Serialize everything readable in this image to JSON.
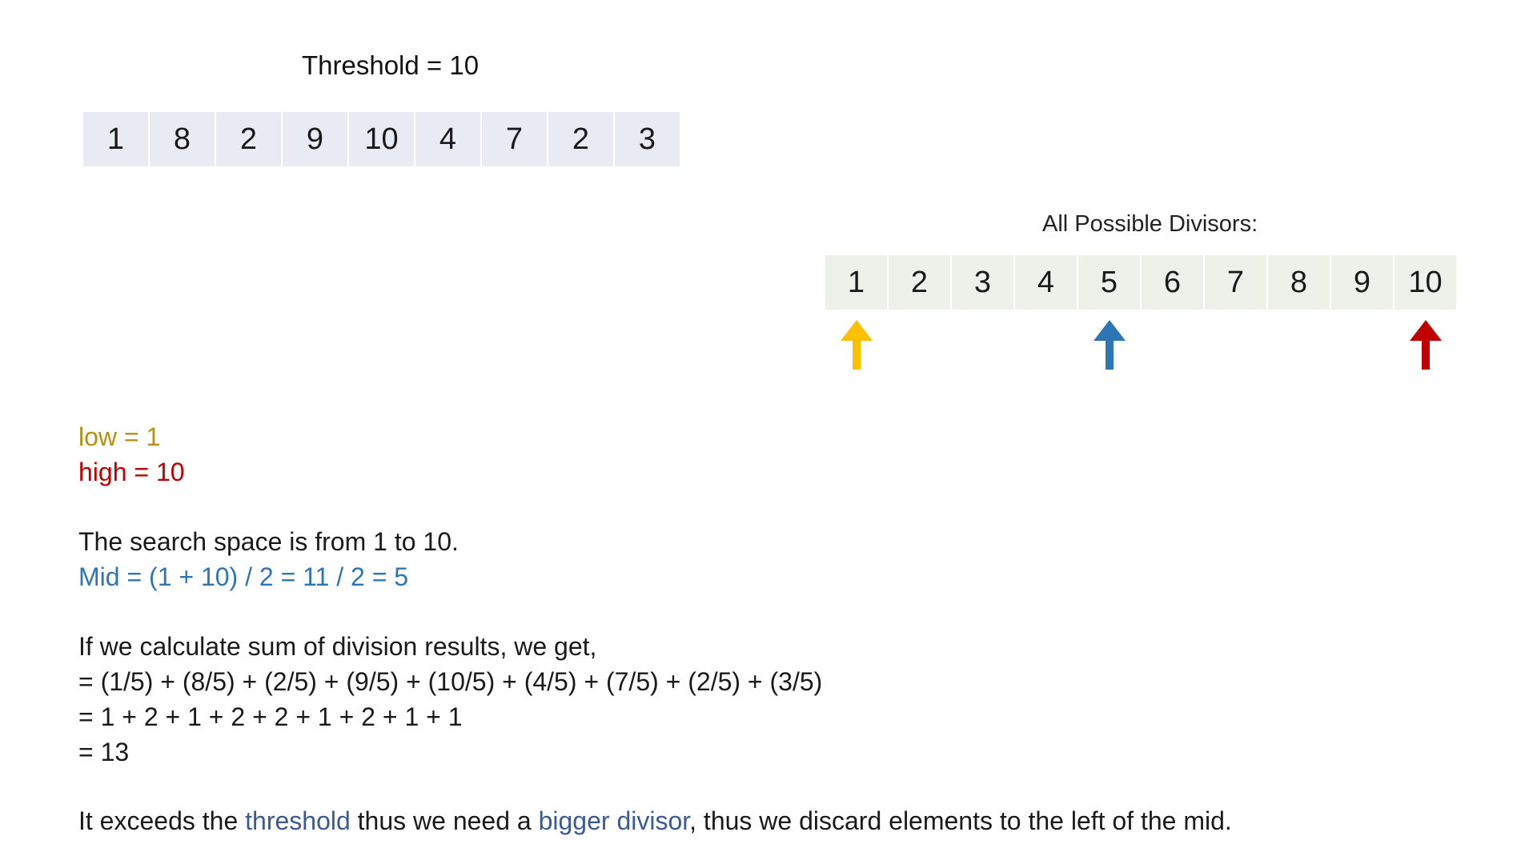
{
  "threshold_title": "Threshold = 10",
  "input_array": [
    "1",
    "8",
    "2",
    "9",
    "10",
    "4",
    "7",
    "2",
    "3"
  ],
  "divisors_label": "All Possible Divisors:",
  "divisors": [
    "1",
    "2",
    "3",
    "4",
    "5",
    "6",
    "7",
    "8",
    "9",
    "10"
  ],
  "pointers": [
    {
      "name": "low",
      "target_index": 0,
      "color": "#ffc000"
    },
    {
      "name": "mid",
      "target_index": 4,
      "color": "#2e75b6"
    },
    {
      "name": "high",
      "target_index": 9,
      "color": "#c00000"
    }
  ],
  "low_text": "low = 1",
  "high_text": "high = 10",
  "search_space_text": "The search space is from 1 to 10.",
  "mid_text": "Mid = (1 + 10) / 2 = 11 / 2 = 5",
  "calc_intro": "If we calculate sum of division results, we get,",
  "calc_line1": "= (1/5) + (8/5) + (2/5) + (9/5) + (10/5) + (4/5) + (7/5) + (2/5) + (3/5)",
  "calc_line2": "= 1 + 2 + 1 + 2 + 2 + 1 + 2 + 1 + 1",
  "calc_line3": "= 13",
  "conclusion": {
    "part1": "It exceeds the ",
    "highlight1": "threshold",
    "part2": " thus we need a ",
    "highlight2": "bigger divisor",
    "part3": ", thus we discard elements to the left of the mid."
  },
  "colors": {
    "low": "#b8900f",
    "high": "#c00000",
    "mid": "#2e75b6",
    "accent": "#3a5a98",
    "input_cell_bg": "#e9ebf4",
    "divisor_cell_bg": "#edf1ea"
  }
}
